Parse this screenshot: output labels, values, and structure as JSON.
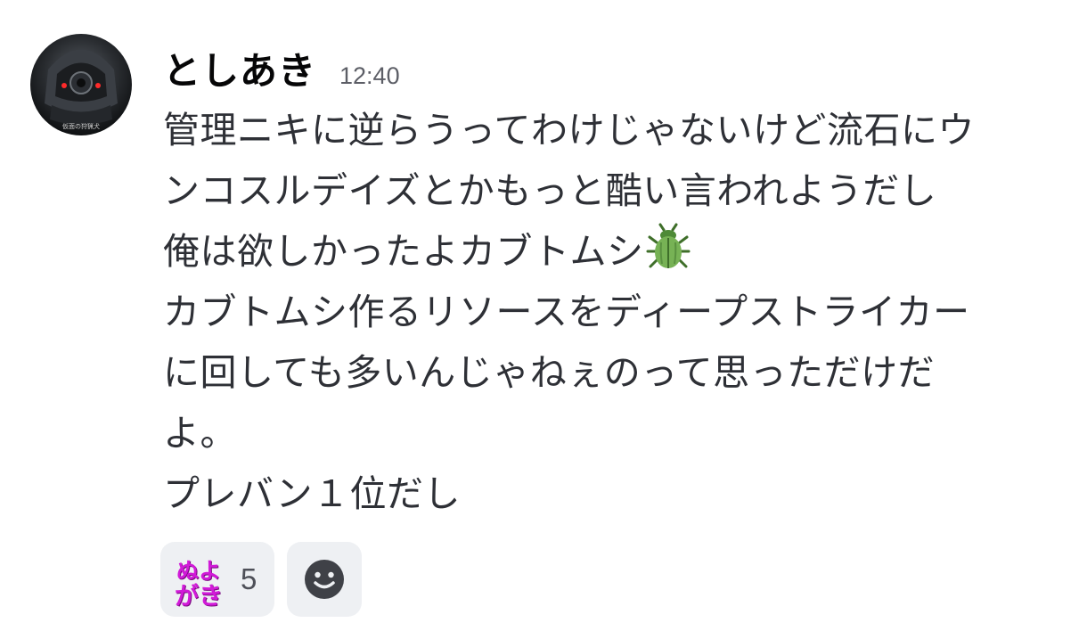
{
  "message": {
    "author": "としあき",
    "time": "12:40",
    "avatar_label": "仮面の狩猟犬",
    "lines": [
      "管理ニキに逆らうってわけじゃないけど流石にウ",
      "ンコスルデイズとかもっと酷い言われようだし",
      "俺は欲しかったよカブトムシ",
      "カブトムシ作るリソースをディープストライカー",
      "に回しても多いんじゃねぇのって思っただけだ",
      "よ。",
      "プレバン１位だし"
    ],
    "inline_emoji": "beetle-icon"
  },
  "reactions": [
    {
      "emoji_text": [
        "ぬよ",
        "がき"
      ],
      "count": "5",
      "emoji_color": "#d11ad8"
    }
  ],
  "add_reaction_icon": "smiley-add-icon",
  "colors": {
    "text": "#2e3036",
    "author": "#060607",
    "timestamp": "#5c5e66",
    "reaction_bg": "#eef0f3",
    "beetle_green": "#6aa84f"
  }
}
